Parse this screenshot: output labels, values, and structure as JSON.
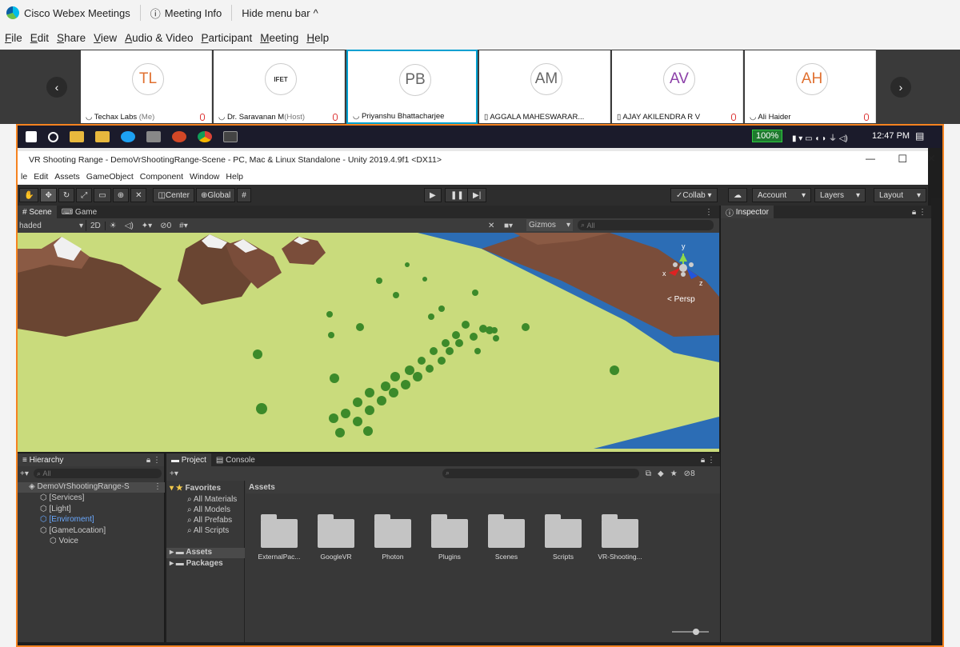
{
  "webex": {
    "app_title": "Cisco Webex Meetings",
    "meeting_info": "Meeting Info",
    "hide_menu": "Hide menu bar",
    "menu": [
      "File",
      "Edit",
      "Share",
      "View",
      "Audio & Video",
      "Participant",
      "Meeting",
      "Help"
    ],
    "participants": [
      {
        "initials": "TL",
        "name": "Techax Labs",
        "tag": "(Me)",
        "color": "#e07030"
      },
      {
        "initials": "",
        "name": "Dr. Saravanan M",
        "tag": "(Host)",
        "color": "#333333",
        "logo_text": "IFET"
      },
      {
        "initials": "PB",
        "name": "Priyanshu Bhattacharjee",
        "tag": "",
        "color": "#666666"
      },
      {
        "initials": "AM",
        "name": "AGGALA MAHESWARAR...",
        "tag": "",
        "color": "#666666"
      },
      {
        "initials": "AV",
        "name": "AJAY AKILENDRA R V",
        "tag": "",
        "color": "#8b3fa8"
      },
      {
        "initials": "AH",
        "name": "Ali Haider",
        "tag": "",
        "color": "#e07030"
      }
    ]
  },
  "taskbar": {
    "battery": "100%",
    "time": "12:47 PM"
  },
  "unity": {
    "title": "VR Shooting Range - DemoVrShootingRange-Scene - PC, Mac & Linux Standalone - Unity 2019.4.9f1 <DX11>",
    "menu": [
      "le",
      "Edit",
      "Assets",
      "GameObject",
      "Component",
      "Window",
      "Help"
    ],
    "toolbar": {
      "center": "Center",
      "global": "Global",
      "collab": "Collab",
      "account": "Account",
      "layers": "Layers",
      "layout": "Layout"
    },
    "scene_tabs": {
      "scene": "Scene",
      "game": "Game",
      "shading": "haded",
      "mode2d": "2D",
      "gizmos": "Gizmos",
      "search_placeholder": "All",
      "hidden_count": "0",
      "persp": "Persp"
    },
    "inspector": "Inspector",
    "hierarchy": {
      "title": "Hierarchy",
      "search": "All",
      "root": "DemoVrShootingRange-S",
      "items": [
        "[Services]",
        "[Light]",
        "[Enviroment]",
        "[GameLocation]",
        "Voice"
      ]
    },
    "project": {
      "tab": "Project",
      "console": "Console",
      "favorites_title": "Favorites",
      "favorites": [
        "All Materials",
        "All Models",
        "All Prefabs",
        "All Scripts"
      ],
      "roots": [
        "Assets",
        "Packages"
      ],
      "assets_header": "Assets",
      "folders": [
        "ExternalPac...",
        "GoogleVR",
        "Photon",
        "Plugins",
        "Scenes",
        "Scripts",
        "VR-Shooting..."
      ],
      "count": "8"
    }
  }
}
